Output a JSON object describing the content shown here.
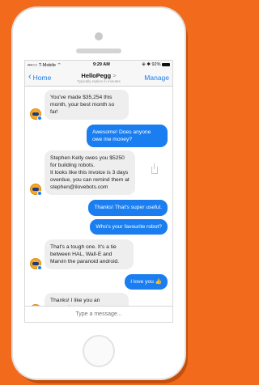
{
  "status_bar": {
    "carrier": "•••○○ T-Mobile ⌔",
    "time": "9:29 AM",
    "battery": "⊕ ✱ 92%"
  },
  "nav": {
    "back_label": "Home",
    "title": "HelloPegg",
    "title_chevron": ">",
    "subtitle": "Typically replies in minutes",
    "manage_label": "Manage"
  },
  "messages": [
    {
      "from": "bot",
      "text": "You've made $35,254 this month, your best month so far!"
    },
    {
      "from": "user",
      "text": "Awesome! Does anyone owe me money?"
    },
    {
      "from": "bot",
      "text": "Stephen Kelly owes you $5250 for building robots.\nIt looks like this invoice is 3 days overdue, you can remind them at stephen@ilovebots.com"
    },
    {
      "from": "user",
      "text": "Thanks! That's super useful."
    },
    {
      "from": "user",
      "text": "Who's your favourite robot?"
    },
    {
      "from": "bot",
      "text": "That's a tough one. It's a tie between HAL, Wall-E and Marvin the paranoid android."
    },
    {
      "from": "user",
      "text": "I love you 👍"
    },
    {
      "from": "bot",
      "text": "Thanks! I like you an appropriate amount."
    }
  ],
  "composer": {
    "placeholder": "Type a message..."
  },
  "colors": {
    "background": "#f26a1b",
    "accent": "#1a7ef0",
    "incoming_bubble": "#eeeeee"
  }
}
